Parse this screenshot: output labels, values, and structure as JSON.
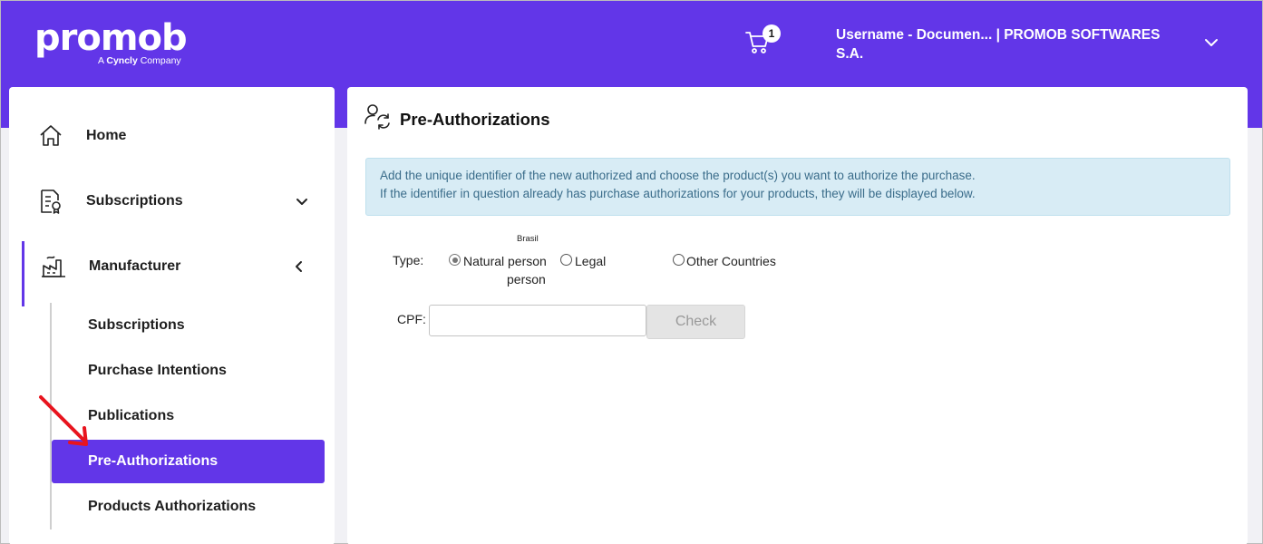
{
  "header": {
    "logo_text": "promob",
    "logo_sub_prefix": "A",
    "logo_sub_brand": "Cyncly",
    "logo_sub_suffix": "Company",
    "cart_count": "1",
    "user_line1": "Username - Documen... | PROMOB SOFTWARES",
    "user_line2": "S.A."
  },
  "sidebar": {
    "home": "Home",
    "subscriptions": "Subscriptions",
    "manufacturer": "Manufacturer",
    "sub_items": [
      "Subscriptions",
      "Purchase Intentions",
      "Publications",
      "Pre-Authorizations",
      "Products Authorizations"
    ],
    "selected_item": "Pre-Authorizations"
  },
  "main": {
    "title": "Pre-Authorizations",
    "info_line1": "Add the unique identifier of the new authorized and choose the product(s) you want to authorize the purchase.",
    "info_line2": "If the identifier in question already has purchase authorizations for your products, they will be displayed below.",
    "type_label": "Type:",
    "brasil_label": "Brasil",
    "radio_natural_line1": "Natural person",
    "radio_natural_line2": "person",
    "radio_legal": "Legal",
    "radio_other": "Other Countries",
    "selected_type": "Natural person",
    "cpf_label": "CPF:",
    "cpf_value": "",
    "check_label": "Check"
  },
  "colors": {
    "brand": "#6236e8",
    "info_bg": "#d8ecf5",
    "info_text": "#3a6c8a",
    "arrow": "#e8141e"
  }
}
